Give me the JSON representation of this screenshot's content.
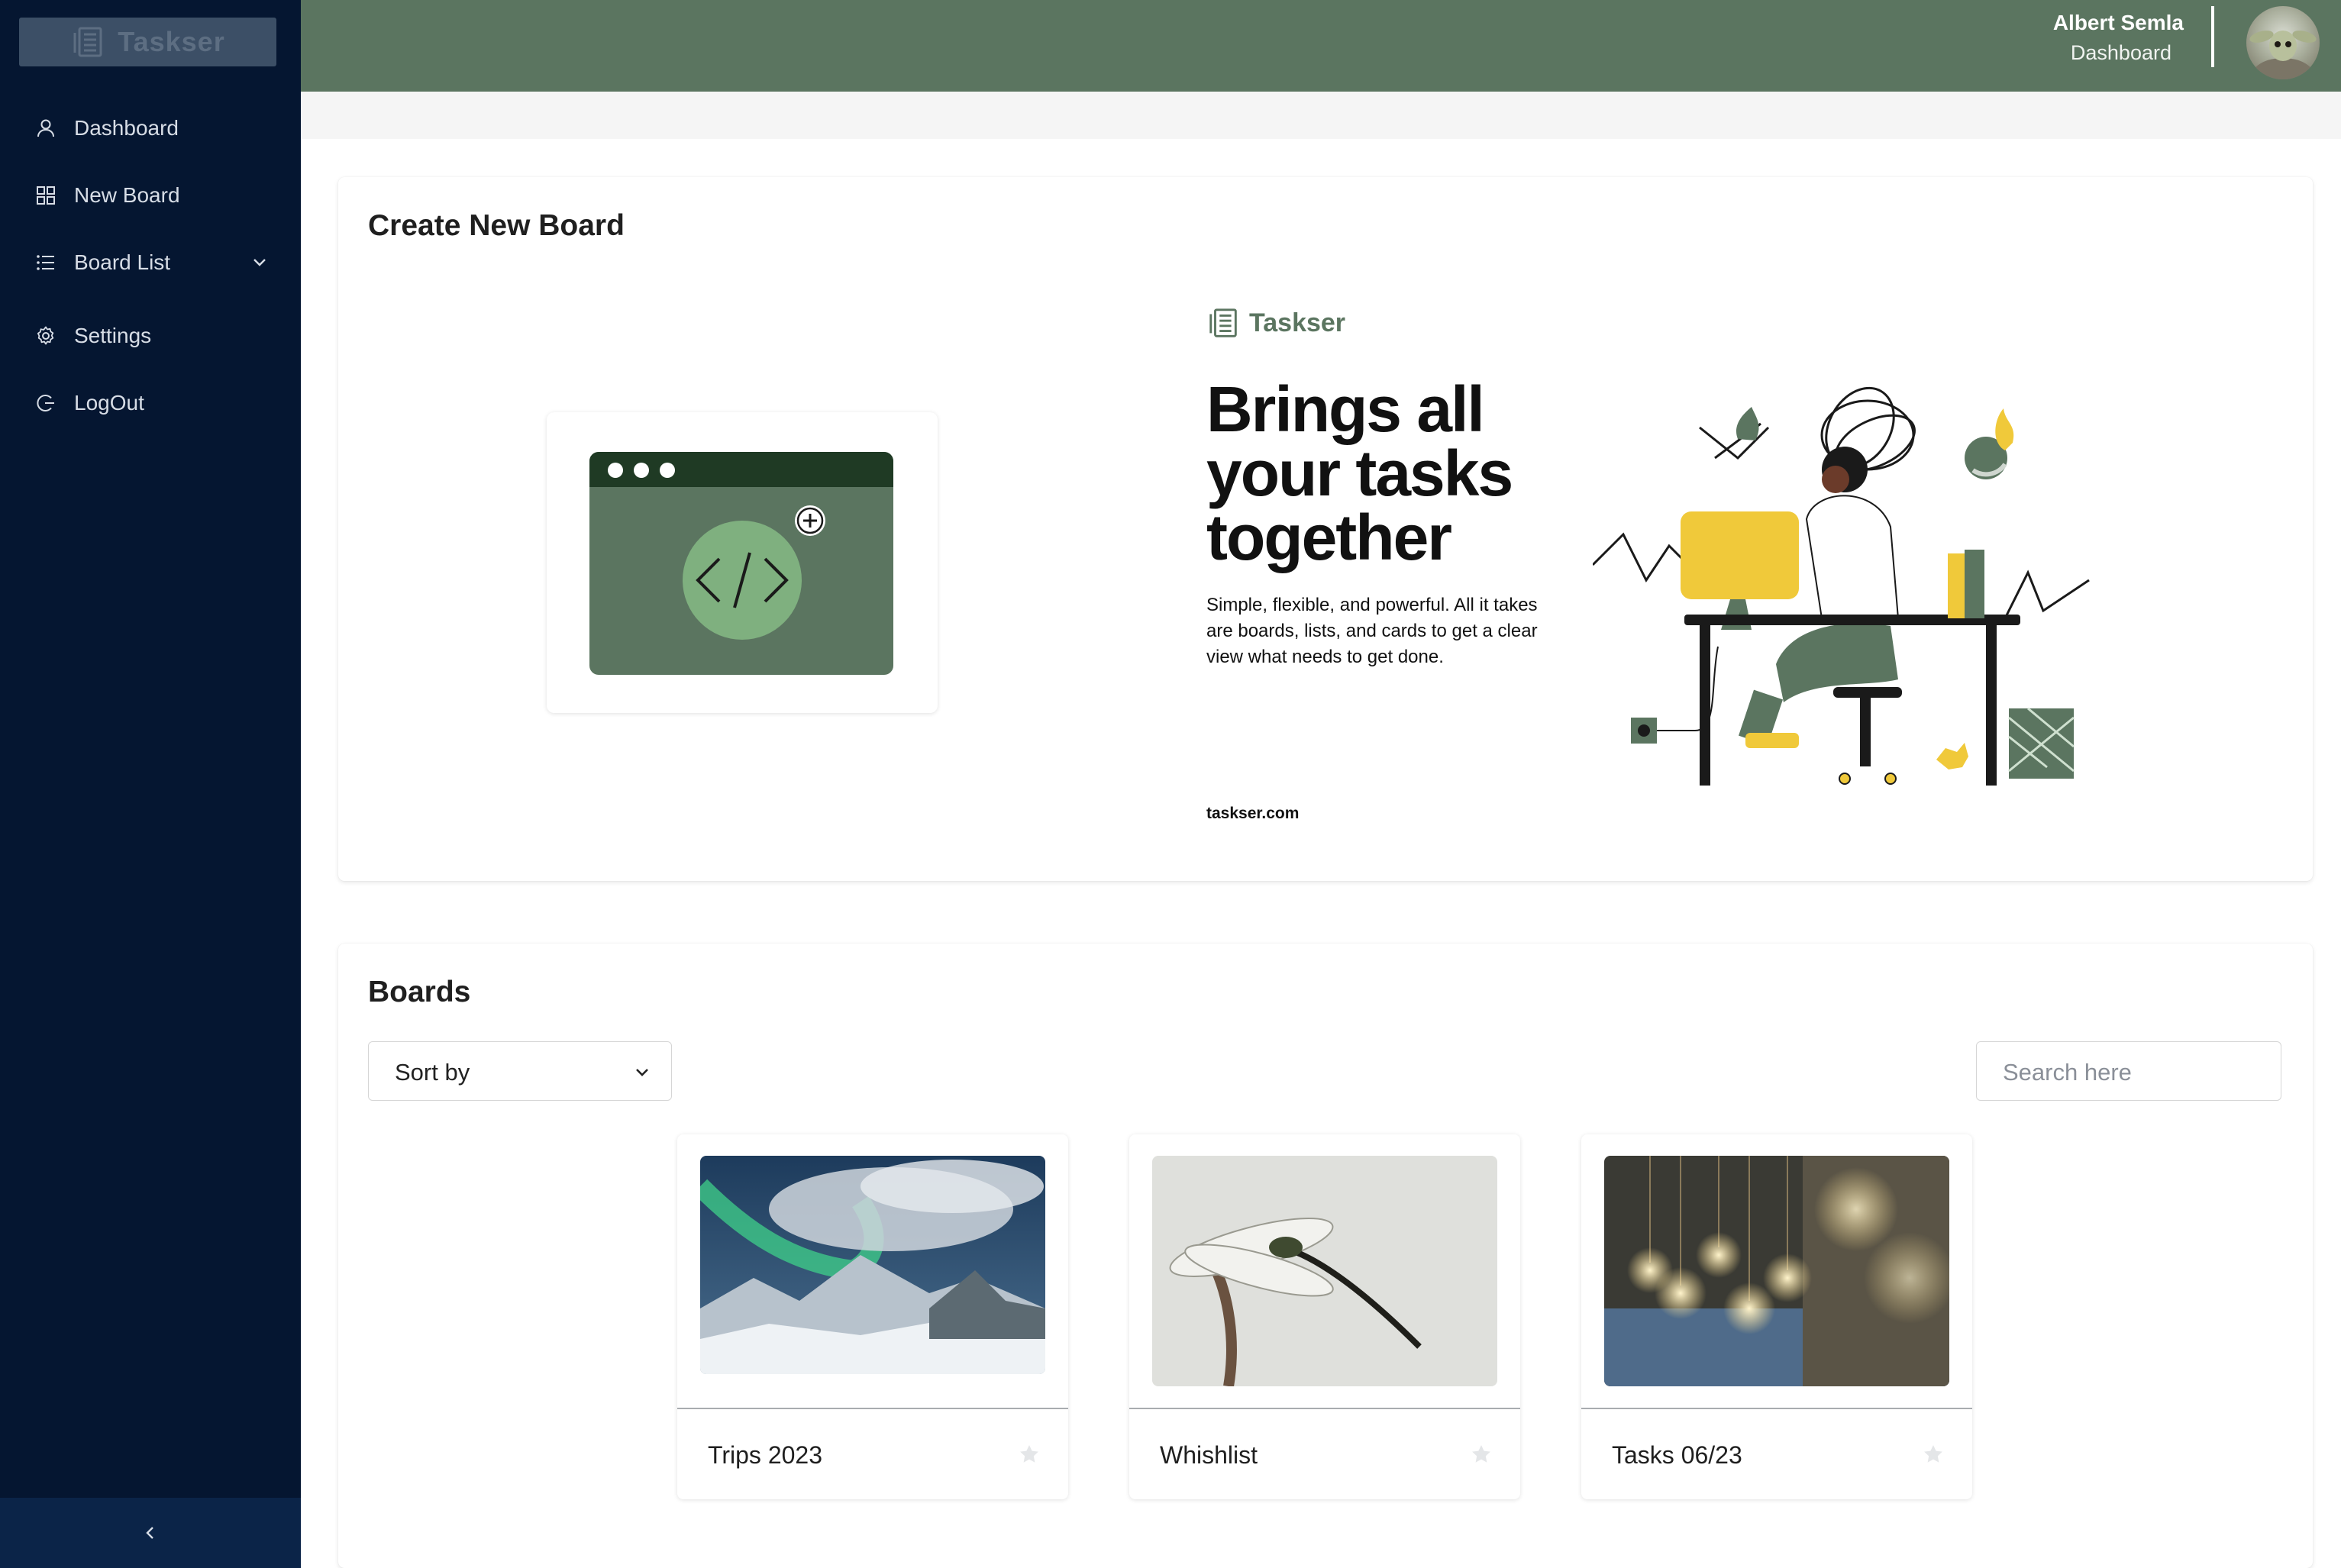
{
  "app": {
    "name": "Taskser"
  },
  "sidebar": {
    "items": [
      {
        "label": "Dashboard",
        "icon": "user-icon"
      },
      {
        "label": "New Board",
        "icon": "grid-icon"
      },
      {
        "label": "Board List",
        "icon": "list-icon",
        "expandable": true
      },
      {
        "label": "Settings",
        "icon": "gear-icon"
      },
      {
        "label": "LogOut",
        "icon": "logout-icon"
      }
    ],
    "collapse_icon": "chevron-left-icon"
  },
  "header": {
    "user_name": "Albert Semla",
    "user_role": "Dashboard",
    "accent_color": "#5b7560"
  },
  "create_board": {
    "title": "Create New Board",
    "promo": {
      "brand": "Taskser",
      "headline": "Brings all your tasks together",
      "description": "Simple, flexible, and powerful. All it takes are boards, lists, and cards to get a clear view what needs to get done.",
      "site": "taskser.com"
    }
  },
  "boards": {
    "title": "Boards",
    "sort_label": "Sort by",
    "search_placeholder": "Search here",
    "items": [
      {
        "title": "Trips 2023",
        "image": "aurora-landscape"
      },
      {
        "title": "Whishlist",
        "image": "dragonfly"
      },
      {
        "title": "Tasks 06/23",
        "image": "light-bulbs"
      }
    ]
  },
  "colors": {
    "sidebar_bg": "#051631",
    "header_bg": "#5b7560",
    "brand_dark": "#1f3a24"
  }
}
